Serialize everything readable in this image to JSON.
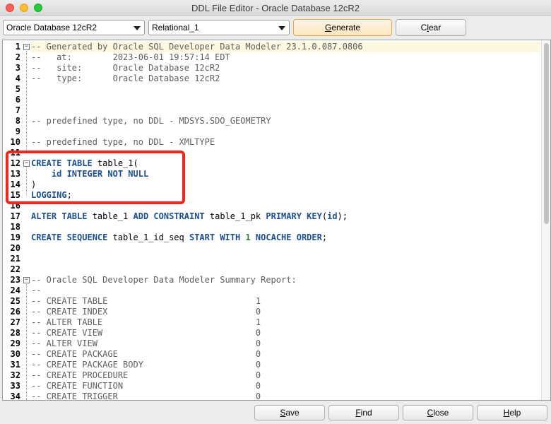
{
  "window": {
    "title": "DDL File Editor - Oracle Database 12cR2"
  },
  "toolbar": {
    "database_select": "Oracle Database 12cR2",
    "model_select": "Relational_1",
    "generate": {
      "u": "G",
      "rest": "enerate"
    },
    "clear": {
      "pre": "C",
      "u": "l",
      "post": "ear"
    }
  },
  "code": [
    {
      "n": "1",
      "hl": true,
      "fold": "box",
      "tokens": [
        [
          "cmt",
          "-- Generated by Oracle SQL Developer Data Modeler 23.1.0.087.0806"
        ]
      ]
    },
    {
      "n": "2",
      "tokens": [
        [
          "cmt",
          "--   at:        2023-06-01 19:57:14 EDT"
        ]
      ]
    },
    {
      "n": "3",
      "tokens": [
        [
          "cmt",
          "--   site:      Oracle Database 12cR2"
        ]
      ]
    },
    {
      "n": "4",
      "tokens": [
        [
          "cmt",
          "--   type:      Oracle Database 12cR2"
        ]
      ]
    },
    {
      "n": "5",
      "tokens": []
    },
    {
      "n": "6",
      "tokens": []
    },
    {
      "n": "7",
      "tokens": []
    },
    {
      "n": "8",
      "tokens": [
        [
          "cmt",
          "-- predefined type, no DDL - MDSYS.SDO_GEOMETRY"
        ]
      ]
    },
    {
      "n": "9",
      "tokens": []
    },
    {
      "n": "10",
      "tokens": [
        [
          "cmt",
          "-- predefined type, no DDL - XMLTYPE"
        ]
      ]
    },
    {
      "n": "11",
      "tokens": []
    },
    {
      "n": "12",
      "fold": "box",
      "tokens": [
        [
          "kw",
          "CREATE TABLE"
        ],
        [
          "plain",
          " table_1("
        ]
      ]
    },
    {
      "n": "13",
      "tokens": [
        [
          "plain",
          "    "
        ],
        [
          "kw",
          "id INTEGER NOT NULL"
        ]
      ]
    },
    {
      "n": "14",
      "tokens": [
        [
          "plain",
          ")"
        ]
      ]
    },
    {
      "n": "15",
      "tokens": [
        [
          "kw",
          "LOGGING"
        ],
        [
          "plain",
          ";"
        ]
      ]
    },
    {
      "n": "16",
      "tokens": []
    },
    {
      "n": "17",
      "tokens": [
        [
          "kw",
          "ALTER TABLE"
        ],
        [
          "plain",
          " table_1 "
        ],
        [
          "kw",
          "ADD CONSTRAINT"
        ],
        [
          "plain",
          " table_1_pk "
        ],
        [
          "kw",
          "PRIMARY KEY"
        ],
        [
          "plain",
          "("
        ],
        [
          "kw",
          "id"
        ],
        [
          "plain",
          ");"
        ]
      ]
    },
    {
      "n": "18",
      "tokens": []
    },
    {
      "n": "19",
      "tokens": [
        [
          "kw",
          "CREATE SEQUENCE"
        ],
        [
          "plain",
          " table_1_id_seq "
        ],
        [
          "kw",
          "START WITH"
        ],
        [
          "plain",
          " "
        ],
        [
          "num",
          "1"
        ],
        [
          "plain",
          " "
        ],
        [
          "kw",
          "NOCACHE ORDER"
        ],
        [
          "plain",
          ";"
        ]
      ]
    },
    {
      "n": "20",
      "tokens": []
    },
    {
      "n": "21",
      "tokens": []
    },
    {
      "n": "22",
      "tokens": []
    },
    {
      "n": "23",
      "fold": "box",
      "tokens": [
        [
          "cmt",
          "-- Oracle SQL Developer Data Modeler Summary Report:"
        ]
      ]
    },
    {
      "n": "24",
      "tokens": [
        [
          "cmt",
          "--"
        ]
      ]
    },
    {
      "n": "25",
      "tokens": [
        [
          "cmt",
          "-- CREATE TABLE                             1"
        ]
      ]
    },
    {
      "n": "26",
      "tokens": [
        [
          "cmt",
          "-- CREATE INDEX                             0"
        ]
      ]
    },
    {
      "n": "27",
      "tokens": [
        [
          "cmt",
          "-- ALTER TABLE                              1"
        ]
      ]
    },
    {
      "n": "28",
      "tokens": [
        [
          "cmt",
          "-- CREATE VIEW                              0"
        ]
      ]
    },
    {
      "n": "29",
      "tokens": [
        [
          "cmt",
          "-- ALTER VIEW                               0"
        ]
      ]
    },
    {
      "n": "30",
      "tokens": [
        [
          "cmt",
          "-- CREATE PACKAGE                           0"
        ]
      ]
    },
    {
      "n": "31",
      "tokens": [
        [
          "cmt",
          "-- CREATE PACKAGE BODY                      0"
        ]
      ]
    },
    {
      "n": "32",
      "tokens": [
        [
          "cmt",
          "-- CREATE PROCEDURE                         0"
        ]
      ]
    },
    {
      "n": "33",
      "tokens": [
        [
          "cmt",
          "-- CREATE FUNCTION                          0"
        ]
      ]
    },
    {
      "n": "34",
      "tokens": [
        [
          "cmt",
          "-- CREATE TRIGGER                           0"
        ]
      ]
    }
  ],
  "footer": {
    "save": {
      "u": "S",
      "rest": "ave"
    },
    "find": {
      "u": "F",
      "rest": "ind"
    },
    "close": {
      "u": "C",
      "rest": "lose"
    },
    "help": {
      "u": "H",
      "rest": "elp"
    }
  },
  "colors": {
    "annotation": "#f1261c",
    "keyword": "#1c4f8f",
    "comment": "#5e5e5e",
    "number": "#2e7d32",
    "generate_border": "#e7a64a"
  }
}
